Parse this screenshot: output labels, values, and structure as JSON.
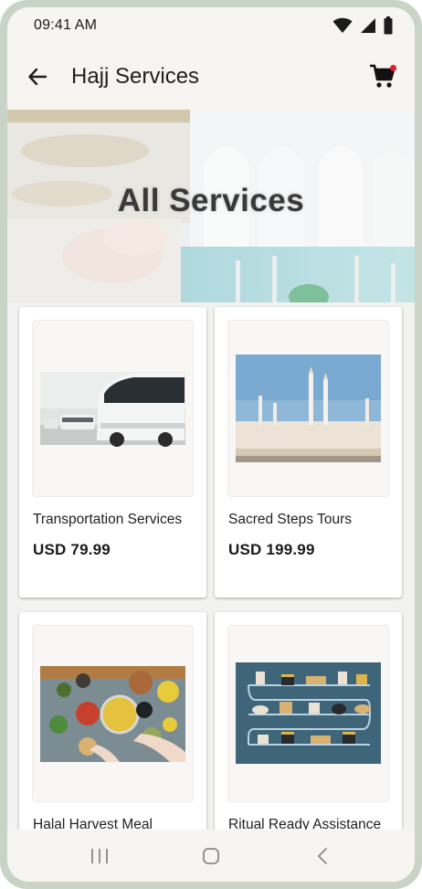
{
  "status_bar": {
    "time": "09:41 AM"
  },
  "app_bar": {
    "title": "Hajj Services"
  },
  "hero": {
    "title": "All Services"
  },
  "services": [
    {
      "title": "Transportation Services",
      "price": "USD 79.99",
      "image": "bus-photo"
    },
    {
      "title": "Sacred Steps Tours",
      "price": "USD 199.99",
      "image": "mosque-photo"
    },
    {
      "title": "Halal Harvest Meal",
      "price": "",
      "image": "food-table-photo"
    },
    {
      "title": "Ritual Ready Assistance",
      "price": "",
      "image": "ritual-illustration"
    }
  ],
  "colors": {
    "accent_dot": "#e01d2d",
    "background": "#f2f2f0",
    "bars": "#f7f5f2"
  }
}
